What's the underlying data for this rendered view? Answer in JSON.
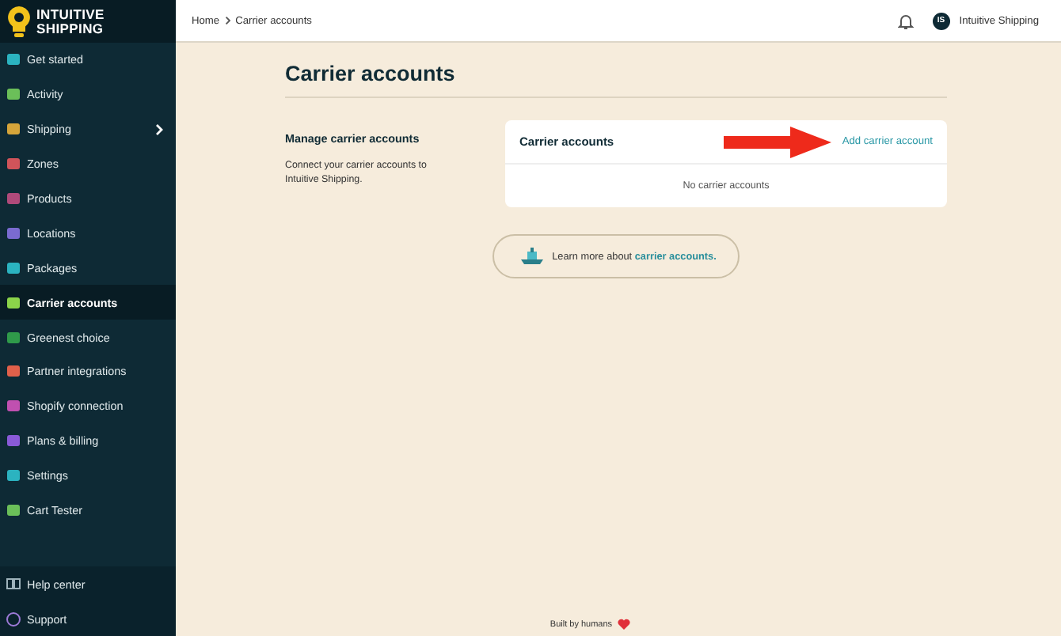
{
  "logo": {
    "line_1": "INTUITIVE",
    "line_2": "SHIPPING"
  },
  "sidebar": {
    "items": [
      {
        "label": "Get started",
        "color": "#2bb3c0",
        "selected": false,
        "expandable": false
      },
      {
        "label": "Activity",
        "color": "#6bbf59",
        "selected": false,
        "expandable": false
      },
      {
        "label": "Shipping",
        "color": "#d6a53a",
        "selected": false,
        "expandable": true
      },
      {
        "label": "Zones",
        "color": "#d0545a",
        "selected": false,
        "expandable": false
      },
      {
        "label": "Products",
        "color": "#b04a7a",
        "selected": false,
        "expandable": false
      },
      {
        "label": "Locations",
        "color": "#7a6bd0",
        "selected": false,
        "expandable": false
      },
      {
        "label": "Packages",
        "color": "#2bb3c0",
        "selected": false,
        "expandable": false
      },
      {
        "label": "Carrier accounts",
        "color": "#8bd44a",
        "selected": true,
        "expandable": false
      },
      {
        "label": "Greenest choice",
        "color": "#2f9a4a",
        "selected": false,
        "expandable": false
      },
      {
        "label": "Partner integrations",
        "color": "#e0604a",
        "selected": false,
        "expandable": false
      },
      {
        "label": "Shopify connection",
        "color": "#c050b0",
        "selected": false,
        "expandable": false
      },
      {
        "label": "Plans & billing",
        "color": "#8a5ad8",
        "selected": false,
        "expandable": false
      },
      {
        "label": "Settings",
        "color": "#2bb3c0",
        "selected": false,
        "expandable": false
      },
      {
        "label": "Cart Tester",
        "color": "#6bbf59",
        "selected": false,
        "expandable": false
      }
    ],
    "footer_items": [
      {
        "label": "Help center"
      },
      {
        "label": "Support"
      }
    ]
  },
  "breadcrumb": [
    "Home",
    "Carrier accounts"
  ],
  "user": {
    "initials": "IS",
    "name": "Intuitive Shipping"
  },
  "page_title": "Carrier accounts",
  "section": {
    "heading": "Manage carrier accounts",
    "description": "Connect your carrier accounts to Intuitive Shipping."
  },
  "card": {
    "title": "Carrier accounts",
    "action": "Add carrier account",
    "empty_text": "No carrier accounts"
  },
  "learn_more": {
    "text": "Learn more about ",
    "link": "carrier accounts."
  },
  "footer": {
    "text": "Built by humans"
  }
}
